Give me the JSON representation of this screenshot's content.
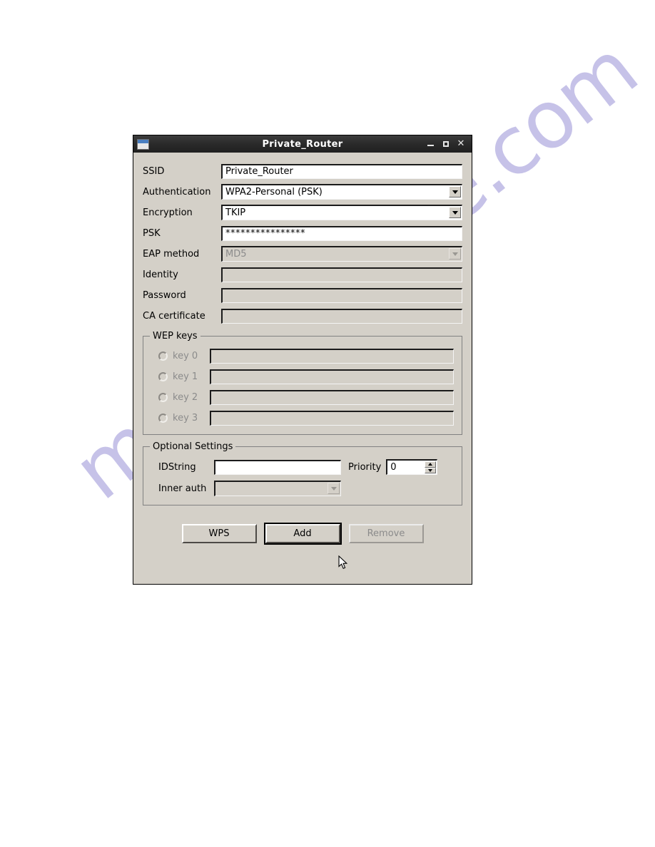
{
  "window": {
    "title": "Private_Router",
    "icon": "window-icon",
    "controls": {
      "minimize": "minimize-icon",
      "maximize": "maximize-icon",
      "close": "✕"
    }
  },
  "form": {
    "fields": [
      {
        "label": "SSID",
        "type": "entry",
        "value": "Private_Router",
        "disabled": false
      },
      {
        "label": "Authentication",
        "type": "combo",
        "value": "WPA2-Personal (PSK)",
        "disabled": false
      },
      {
        "label": "Encryption",
        "type": "combo",
        "value": "TKIP",
        "disabled": false
      },
      {
        "label": "PSK",
        "type": "entry",
        "value": "****************",
        "disabled": false
      },
      {
        "label": "EAP method",
        "type": "combo",
        "value": "MD5",
        "disabled": true
      },
      {
        "label": "Identity",
        "type": "entry",
        "value": "",
        "disabled": true
      },
      {
        "label": "Password",
        "type": "entry",
        "value": "",
        "disabled": true
      },
      {
        "label": "CA certificate",
        "type": "entry",
        "value": "",
        "disabled": true
      }
    ]
  },
  "wep_keys": {
    "title": "WEP keys",
    "rows": [
      {
        "label": "key 0",
        "value": "",
        "selected": false
      },
      {
        "label": "key 1",
        "value": "",
        "selected": false
      },
      {
        "label": "key 2",
        "value": "",
        "selected": false
      },
      {
        "label": "key 3",
        "value": "",
        "selected": false
      }
    ]
  },
  "optional_settings": {
    "title": "Optional Settings",
    "idstring_label": "IDString",
    "idstring_value": "",
    "priority_label": "Priority",
    "priority_value": "0",
    "inner_auth_label": "Inner auth",
    "inner_auth_value": ""
  },
  "buttons": [
    {
      "label": "WPS",
      "state": "normal"
    },
    {
      "label": "Add",
      "state": "default"
    },
    {
      "label": "Remove",
      "state": "disabled"
    }
  ],
  "watermark": {
    "text": "manualshive.com"
  },
  "colors": {
    "dialog_bg": "#d4d0c8",
    "titlebar_bg": "#2a2a2a",
    "titlebar_text": "#ffffff",
    "field_bg": "#ffffff",
    "disabled_text": "#8b8b8b",
    "page_bg": "#ffffff",
    "watermark": "#766ec8"
  }
}
